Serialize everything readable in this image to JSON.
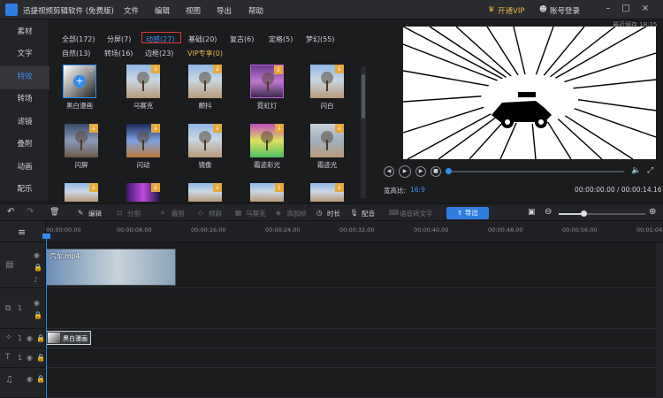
{
  "app": {
    "title": "迅捷视频剪辑软件 (免费版)"
  },
  "menu": [
    "文件",
    "编辑",
    "视图",
    "导出",
    "帮助"
  ],
  "header": {
    "vip": "开通VIP",
    "login": "账号登录",
    "autosave": "最近保存 18:25"
  },
  "sidebar": {
    "items": [
      "素材",
      "文字",
      "特效",
      "转场",
      "滤镜",
      "叠附",
      "动画",
      "配乐"
    ],
    "active_index": 2
  },
  "library": {
    "categories": [
      {
        "label": "全部(172)"
      },
      {
        "label": "分屏(7)"
      },
      {
        "label": "动感(27)",
        "selected": true
      },
      {
        "label": "基础(20)"
      },
      {
        "label": "复古(6)"
      },
      {
        "label": "定格(5)"
      },
      {
        "label": "梦幻(55)"
      },
      {
        "label": "自然(13)"
      },
      {
        "label": "转场(16)"
      },
      {
        "label": "边框(23)"
      },
      {
        "label": "VIP专享(0)",
        "vip": true
      }
    ],
    "tiles": [
      {
        "label": "黑白漫画"
      },
      {
        "label": "马赛克"
      },
      {
        "label": "颤抖"
      },
      {
        "label": "霓虹灯"
      },
      {
        "label": "闪白"
      },
      {
        "label": "闪屏"
      },
      {
        "label": "闪动"
      },
      {
        "label": "镜像"
      },
      {
        "label": "霜迹彩光"
      },
      {
        "label": "霜迹光"
      },
      {
        "label": ""
      },
      {
        "label": ""
      },
      {
        "label": ""
      },
      {
        "label": ""
      },
      {
        "label": ""
      }
    ]
  },
  "player": {
    "aspect_label": "宽高比:",
    "aspect_value": "16:9",
    "time": "00:00:00.00 / 00:00:14.16"
  },
  "toolbar": {
    "edit": "编辑",
    "split": "分割",
    "crop": "裁剪",
    "rotate": "倾斜",
    "mosaic": "马赛克",
    "motion": "添加帧",
    "duration": "时长",
    "dub": "配音",
    "speech": "语音转文字",
    "export": "导出"
  },
  "timeline": {
    "ruler": [
      "00:00:00.00",
      "00:00:08.00",
      "00:00:16.00",
      "00:00:24.00",
      "00:00:32.00",
      "00:00:40.00",
      "00:00:48.00",
      "00:00:56.00",
      "00:01:04.00"
    ],
    "video_clip": "汽车.mp4",
    "effect_clip": "黑白漫画",
    "track_nums": [
      "1",
      "1",
      "1"
    ]
  },
  "colors": {
    "accent": "#2f7de1",
    "vip": "#e6b54a",
    "highlight": "#e23a3a"
  }
}
